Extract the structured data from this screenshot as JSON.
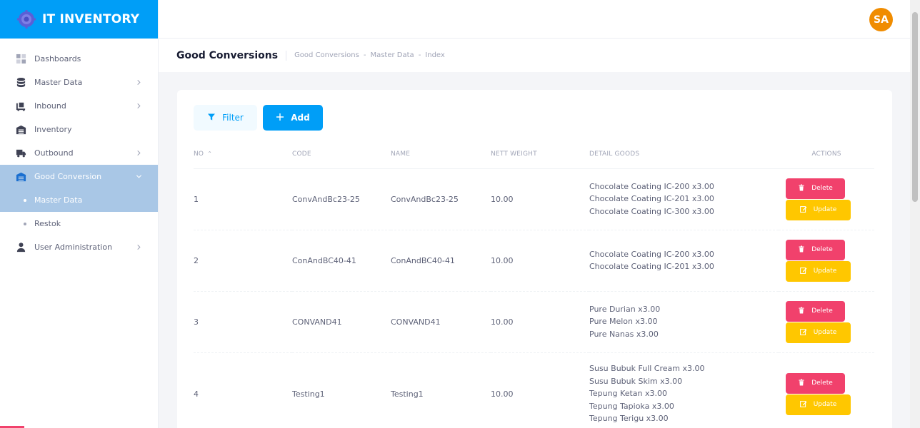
{
  "brand": {
    "name": "IT INVENTORY"
  },
  "header": {
    "avatar_initials": "SA"
  },
  "sidebar": {
    "items": [
      {
        "label": "Dashboards",
        "icon": "dashboard-icon",
        "chevron": ""
      },
      {
        "label": "Master Data",
        "icon": "database-icon",
        "chevron": "right"
      },
      {
        "label": "Inbound",
        "icon": "inbound-truck-icon",
        "chevron": "right"
      },
      {
        "label": "Inventory",
        "icon": "warehouse-icon",
        "chevron": ""
      },
      {
        "label": "Outbound",
        "icon": "truck-icon",
        "chevron": "right"
      },
      {
        "label": "Good Conversion",
        "icon": "warehouse-icon",
        "chevron": "down",
        "active": true
      },
      {
        "label": "Master Data",
        "sub": true,
        "active": true
      },
      {
        "label": "Restok",
        "sub": true
      },
      {
        "label": "User Administration",
        "icon": "user-icon",
        "chevron": "right"
      }
    ]
  },
  "toolbar": {
    "title": "Good Conversions",
    "breadcrumb": [
      "Good Conversions",
      "-",
      "Master Data",
      "-",
      "Index"
    ]
  },
  "actions": {
    "filter_label": "Filter",
    "add_label": "Add"
  },
  "table": {
    "headers": {
      "no": "NO",
      "code": "CODE",
      "name": "NAME",
      "nett": "NETT WEIGHT",
      "detail": "DETAIL GOODS",
      "actions": "ACTIONS"
    },
    "delete_label": "Delete",
    "update_label": "Update",
    "rows": [
      {
        "no": "1",
        "code": "ConvAndBc23-25",
        "name": "ConvAndBc23-25",
        "nett": "10.00",
        "details": [
          "Chocolate Coating IC-200 x3.00",
          "Chocolate Coating IC-201 x3.00",
          "Chocolate Coating IC-300 x3.00"
        ]
      },
      {
        "no": "2",
        "code": "ConAndBC40-41",
        "name": "ConAndBC40-41",
        "nett": "10.00",
        "details": [
          "Chocolate Coating IC-200 x3.00",
          "Chocolate Coating IC-201 x3.00"
        ]
      },
      {
        "no": "3",
        "code": "CONVAND41",
        "name": "CONVAND41",
        "nett": "10.00",
        "details": [
          "Pure Durian x3.00",
          "Pure Melon x3.00",
          "Pure Nanas x3.00"
        ]
      },
      {
        "no": "4",
        "code": "Testing1",
        "name": "Testing1",
        "nett": "10.00",
        "details": [
          "Susu Bubuk Full Cream x3.00",
          "Susu Bubuk Skim x3.00",
          "Tepung Ketan x3.00",
          "Tepung Tapioka x3.00",
          "Tepung Terigu x3.00"
        ]
      }
    ]
  },
  "colors": {
    "primary": "#009ef7",
    "danger": "#f1416c",
    "warning": "#ffc700",
    "avatar": "#f08c00",
    "active_menu": "#a9c7e6"
  }
}
